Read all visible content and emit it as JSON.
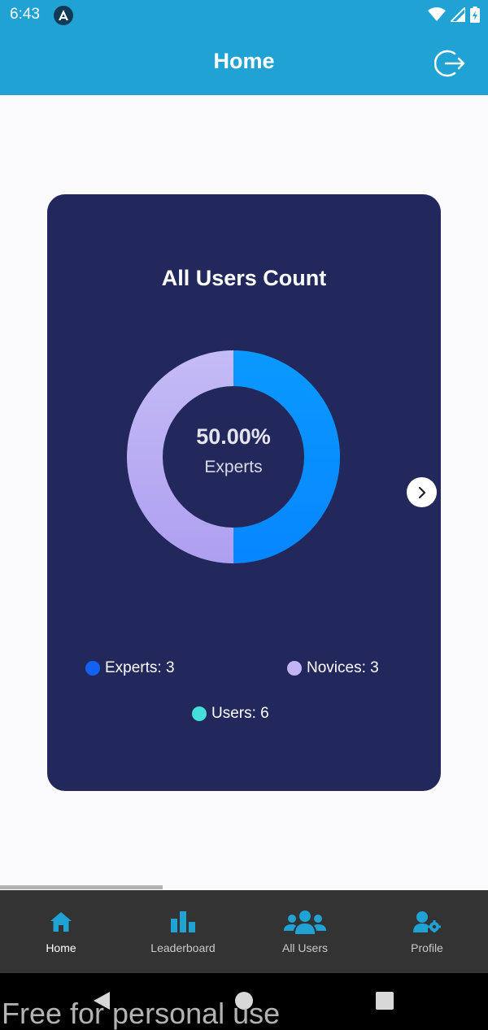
{
  "status_bar": {
    "time": "6:43",
    "icons": [
      "app-notification-icon",
      "wifi-icon",
      "signal-icon",
      "battery-icon"
    ]
  },
  "app_bar": {
    "title": "Home",
    "action_icon": "logout-icon"
  },
  "card": {
    "title": "All Users Count",
    "center_value": "50.00%",
    "center_label": "Experts",
    "next_icon": "chevron-right-icon"
  },
  "chart_data": {
    "type": "pie",
    "title": "All Users Count",
    "categories": [
      "Experts",
      "Novices"
    ],
    "values": [
      3,
      3
    ],
    "colors": [
      "#0a95ff",
      "#b5a8f2"
    ]
  },
  "legend": [
    {
      "label": "Experts: 3",
      "color": "#1261f5"
    },
    {
      "label": "Novices: 3",
      "color": "#c3b5f5"
    },
    {
      "label": "Users: 6",
      "color": "#45dfd9"
    }
  ],
  "bottom_nav": {
    "items": [
      {
        "label": "Home",
        "icon": "home-icon",
        "active": true
      },
      {
        "label": "Leaderboard",
        "icon": "bar-chart-icon",
        "active": false
      },
      {
        "label": "All Users",
        "icon": "users-icon",
        "active": false
      },
      {
        "label": "Profile",
        "icon": "user-gear-icon",
        "active": false
      }
    ],
    "active_color": "#21a2d4"
  },
  "system_nav": {
    "buttons": [
      "back-icon",
      "home-circle-icon",
      "recents-icon"
    ]
  },
  "watermark": "Free for personal use",
  "colors": {
    "header": "#21a2d4",
    "card": "#23285c",
    "background": "#fbfbfe"
  }
}
